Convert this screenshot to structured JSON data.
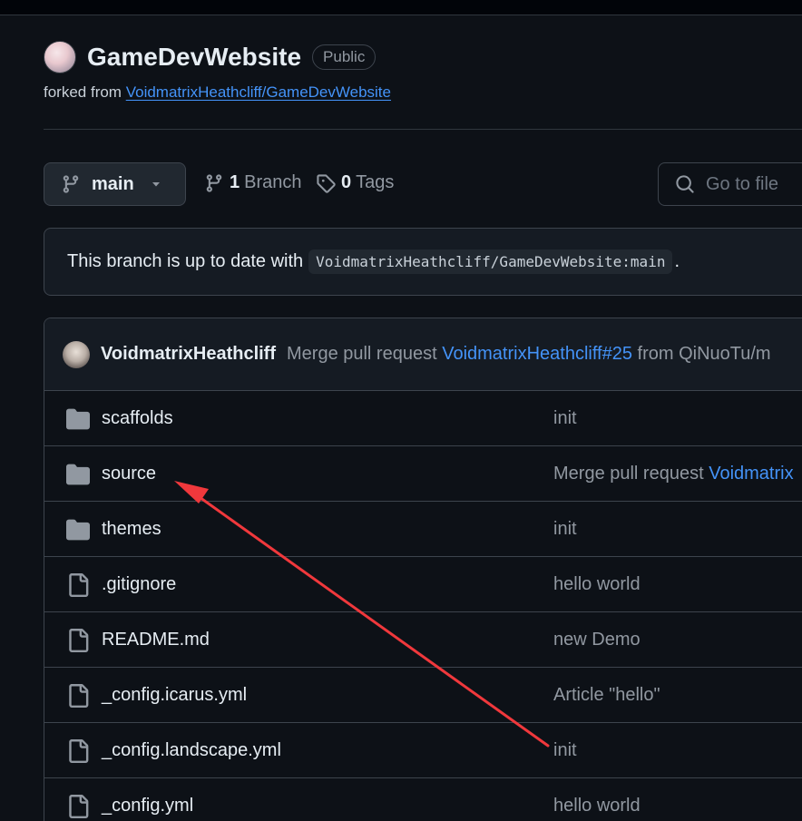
{
  "repo": {
    "name": "GameDevWebsite",
    "visibility": "Public",
    "forked_prefix": "forked from",
    "forked_from": "VoidmatrixHeathcliff/GameDevWebsite"
  },
  "toolbar": {
    "branch": "main",
    "branch_count": "1",
    "branch_label": "Branch",
    "tag_count": "0",
    "tag_label": "Tags",
    "goto_placeholder": "Go to file"
  },
  "banner": {
    "text": "This branch is up to date with",
    "ref": "VoidmatrixHeathcliff/GameDevWebsite:main",
    "suffix": "."
  },
  "latest_commit": {
    "author": "VoidmatrixHeathcliff",
    "message_prefix": "Merge pull request",
    "pr_link": "VoidmatrixHeathcliff#25",
    "message_suffix": "from QiNuoTu/m"
  },
  "files": [
    {
      "name": "scaffolds",
      "type": "folder",
      "message": "init"
    },
    {
      "name": "source",
      "type": "folder",
      "message": "Merge pull request ",
      "message_link": "Voidmatrix"
    },
    {
      "name": "themes",
      "type": "folder",
      "message": "init"
    },
    {
      "name": ".gitignore",
      "type": "file",
      "message": "hello world"
    },
    {
      "name": "README.md",
      "type": "file",
      "message": "new Demo"
    },
    {
      "name": "_config.icarus.yml",
      "type": "file",
      "message": "Article \"hello\""
    },
    {
      "name": "_config.landscape.yml",
      "type": "file",
      "message": "init"
    },
    {
      "name": "_config.yml",
      "type": "file",
      "message": "hello world"
    }
  ],
  "colors": {
    "background": "#0d1117",
    "link": "#4493f8",
    "annotation_arrow": "#f0383c"
  }
}
